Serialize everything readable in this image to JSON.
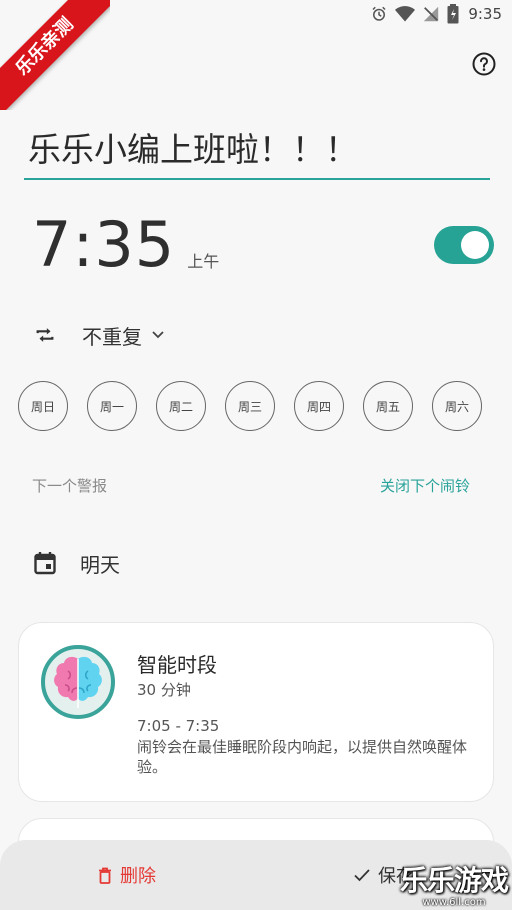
{
  "status_bar": {
    "time": "9:35",
    "icons": [
      "alarm-icon",
      "wifi-icon",
      "signal-icon",
      "battery-icon"
    ]
  },
  "ribbon": {
    "text": "乐乐亲测"
  },
  "header": {
    "help_icon": "question-circle-icon"
  },
  "alarm": {
    "title": "乐乐小编上班啦！！！",
    "time": "7:35",
    "ampm": "上午",
    "enabled": true,
    "repeat_label": "不重复",
    "days": [
      "周日",
      "周一",
      "周二",
      "周三",
      "周四",
      "周五",
      "周六"
    ],
    "next_alarm_label": "下一个警报",
    "skip_next_label": "关闭下个闹铃",
    "date_label": "明天"
  },
  "smart_card": {
    "title": "智能时段",
    "duration": "30 分钟",
    "range": "7:05 - 7:35",
    "description": "闹铃会在最佳睡眠阶段内响起，以提供自然唤醒体验。"
  },
  "bottom_bar": {
    "delete_label": "删除",
    "save_label": "保存"
  },
  "watermark": {
    "main": "乐乐游戏",
    "url": "www.6ll.com"
  },
  "colors": {
    "accent": "#2aa39a",
    "delete": "#e53935",
    "ribbon": "#d9151c"
  }
}
